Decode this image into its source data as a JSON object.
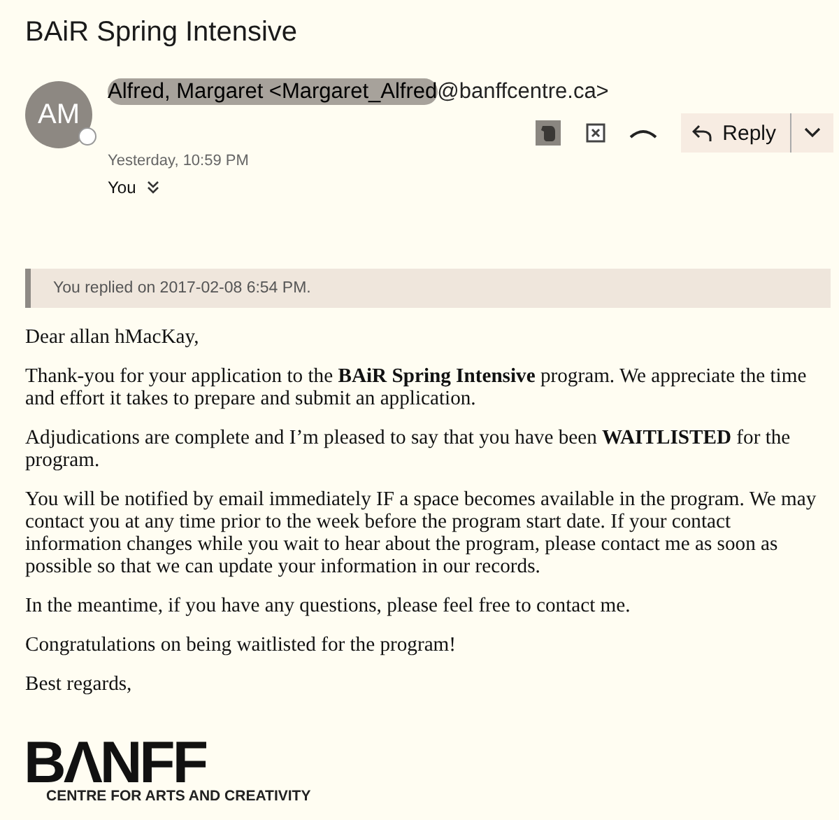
{
  "subject": "BAiR Spring Intensive",
  "sender": {
    "initials": "AM",
    "parts": [
      {
        "text": "Alfred, Margaret <Margaret_Alfred",
        "redacted": true
      },
      {
        "text": "@banffcentre.ca>",
        "redacted": false
      }
    ]
  },
  "toolbar": {
    "reply_label": "Reply"
  },
  "date": "Yesterday, 10:59 PM",
  "recipient": "You",
  "reply_notice": "You replied on 2017-02-08 6:54 PM.",
  "body": [
    "Dear allan hMacKay,",
    "Thank-you for your application to the **BAiR Spring Intensive** program. We appreciate the time and effort it takes to prepare and submit an application.",
    "Adjudications are complete and I’m pleased to say that you have been **WAITLISTED** for the program.",
    "You will be notified by email immediately IF a space becomes available in the program. We may contact you at any time prior to the week before the program start date. If your contact information changes while you wait to hear about the program, please contact me as soon as possible so that we can update your information in our records.",
    "In the meantime, if you have any questions, please feel free to contact me.",
    "Congratulations on being waitlisted for the program!",
    "Best regards,"
  ],
  "logo": {
    "wordmark": "BΛNFF",
    "tagline": "CENTRE FOR ARTS AND CREATIVITY"
  }
}
